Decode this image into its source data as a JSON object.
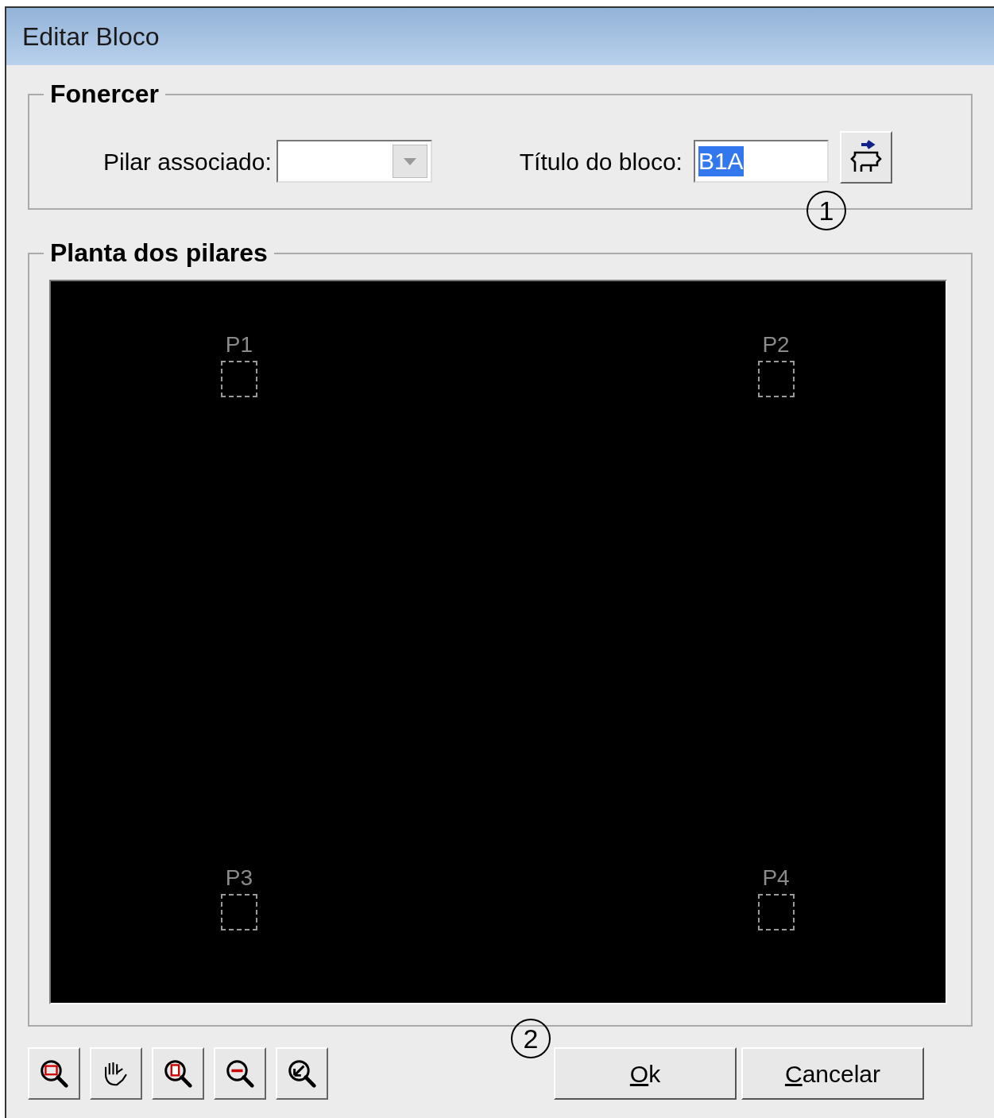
{
  "window": {
    "title": "Editar Bloco"
  },
  "group_main": {
    "title": "Fonercer",
    "pilar_label": "Pilar associado:",
    "titulo_label": "Título do bloco:",
    "titulo_value": "B1A",
    "titulo_selected": true
  },
  "group_plan": {
    "title": "Planta dos pilares",
    "pillars": [
      {
        "label": "P1"
      },
      {
        "label": "P2"
      },
      {
        "label": "P3"
      },
      {
        "label": "P4"
      }
    ]
  },
  "toolbar": [
    {
      "kind": "zoom-window"
    },
    {
      "kind": "pan"
    },
    {
      "kind": "zoom-extents"
    },
    {
      "kind": "zoom-out"
    },
    {
      "kind": "zoom-previous"
    }
  ],
  "buttons": [
    {
      "label": "Ok",
      "first_letter_underlined": true
    },
    {
      "label": "Cancelar",
      "first_letter_underlined": true
    }
  ],
  "callouts": [
    "1",
    "2"
  ]
}
